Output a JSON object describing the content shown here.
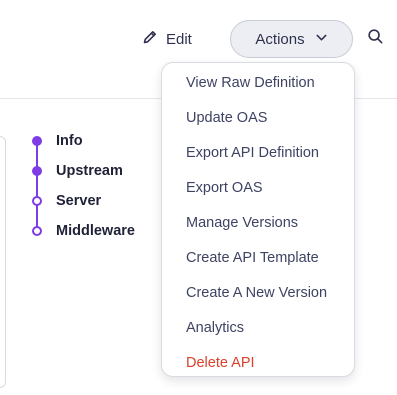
{
  "toolbar": {
    "edit_label": "Edit",
    "actions_label": "Actions"
  },
  "stepper": {
    "accent_color": "#7e3ce6",
    "steps": [
      {
        "label": "Info",
        "state": "filled"
      },
      {
        "label": "Upstream",
        "state": "filled"
      },
      {
        "label": "Server",
        "state": "hollow"
      },
      {
        "label": "Middleware",
        "state": "hollow"
      }
    ]
  },
  "actions_menu": {
    "items": [
      {
        "label": "View Raw Definition"
      },
      {
        "label": "Update OAS"
      },
      {
        "label": "Export API Definition"
      },
      {
        "label": "Export OAS"
      },
      {
        "label": "Manage Versions"
      },
      {
        "label": "Create API Template"
      },
      {
        "label": "Create A New Version"
      },
      {
        "label": "Analytics"
      },
      {
        "label": "Delete API",
        "danger": true
      }
    ],
    "danger_color": "#d9412b"
  },
  "icons": {
    "edit": "pencil-icon",
    "actions": "chevron-down-icon",
    "search": "search-icon"
  }
}
